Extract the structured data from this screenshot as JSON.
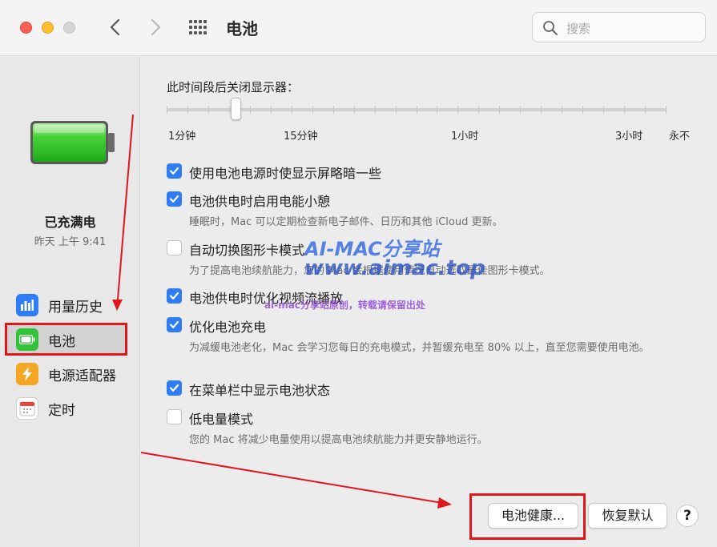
{
  "window": {
    "title": "电池"
  },
  "search": {
    "placeholder": "搜索"
  },
  "sidebar": {
    "status": "已充满电",
    "time": "昨天 上午 9:41",
    "items": [
      {
        "label": "用量历史",
        "icon": "bar-chart-icon"
      },
      {
        "label": "电池",
        "icon": "battery-icon"
      },
      {
        "label": "电源适配器",
        "icon": "lightning-icon"
      },
      {
        "label": "定时",
        "icon": "calendar-icon"
      }
    ]
  },
  "display_off": {
    "label": "此时间段后关闭显示器：",
    "ticks": [
      "1分钟",
      "15分钟",
      "1小时",
      "3小时",
      "永不"
    ],
    "current": "2分钟"
  },
  "options": [
    {
      "label": "使用电池电源时使显示屏略暗一些",
      "checked": true,
      "desc": ""
    },
    {
      "label": "电池供电时启用电能小憩",
      "checked": true,
      "desc": "睡眠时，Mac 可以定期检查新电子邮件、日历和其他 iCloud 更新。"
    },
    {
      "label": "自动切换图形卡模式",
      "checked": false,
      "desc": "为了提高电池续航能力，您的 Mac 会根据使用情况自动选取最佳图形卡模式。"
    },
    {
      "label": "电池供电时优化视频流播放",
      "checked": true,
      "desc": ""
    },
    {
      "label": "优化电池充电",
      "checked": true,
      "desc": "为减缓电池老化，Mac 会学习您每日的充电模式，并暂缓充电至 80% 以上，直至您需要使用电池。"
    },
    {
      "label": "在菜单栏中显示电池状态",
      "checked": true,
      "desc": ""
    },
    {
      "label": "低电量模式",
      "checked": false,
      "desc": "您的 Mac 将减少电量使用以提高电池续航能力并更安静地运行。"
    }
  ],
  "buttons": {
    "health": "电池健康...",
    "restore": "恢复默认",
    "help": "?"
  },
  "watermark": {
    "line1": "AI-MAC分享站",
    "line2": "www.aimac.top",
    "line3": "ai-mac分享站原创，转载请保留出处"
  },
  "colors": {
    "accent": "#2f7df6",
    "highlight": "#e0161b",
    "battery_green": "#3ecb2e"
  }
}
